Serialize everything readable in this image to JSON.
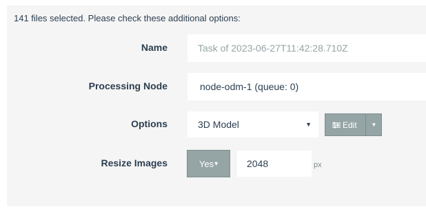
{
  "header": {
    "message": "141 files selected. Please check these additional options:"
  },
  "form": {
    "name": {
      "label": "Name",
      "placeholder": "Task of 2023-06-27T11:42:28.710Z"
    },
    "processing_node": {
      "label": "Processing Node",
      "value": "node-odm-1 (queue: 0)"
    },
    "options": {
      "label": "Options",
      "selected": "3D Model",
      "caret": "▼",
      "edit_label": "Edit",
      "edit_icon": "sliders-icon",
      "edit_caret": "▼"
    },
    "resize_images": {
      "label": "Resize Images",
      "toggle_label": "Yes",
      "toggle_caret": "▾",
      "value": "2048",
      "unit": "px"
    }
  },
  "colors": {
    "panel_bg": "#f5f5f5",
    "button_bg": "#95a5a6",
    "text": "#2c3e50",
    "placeholder": "#95a5a6"
  }
}
